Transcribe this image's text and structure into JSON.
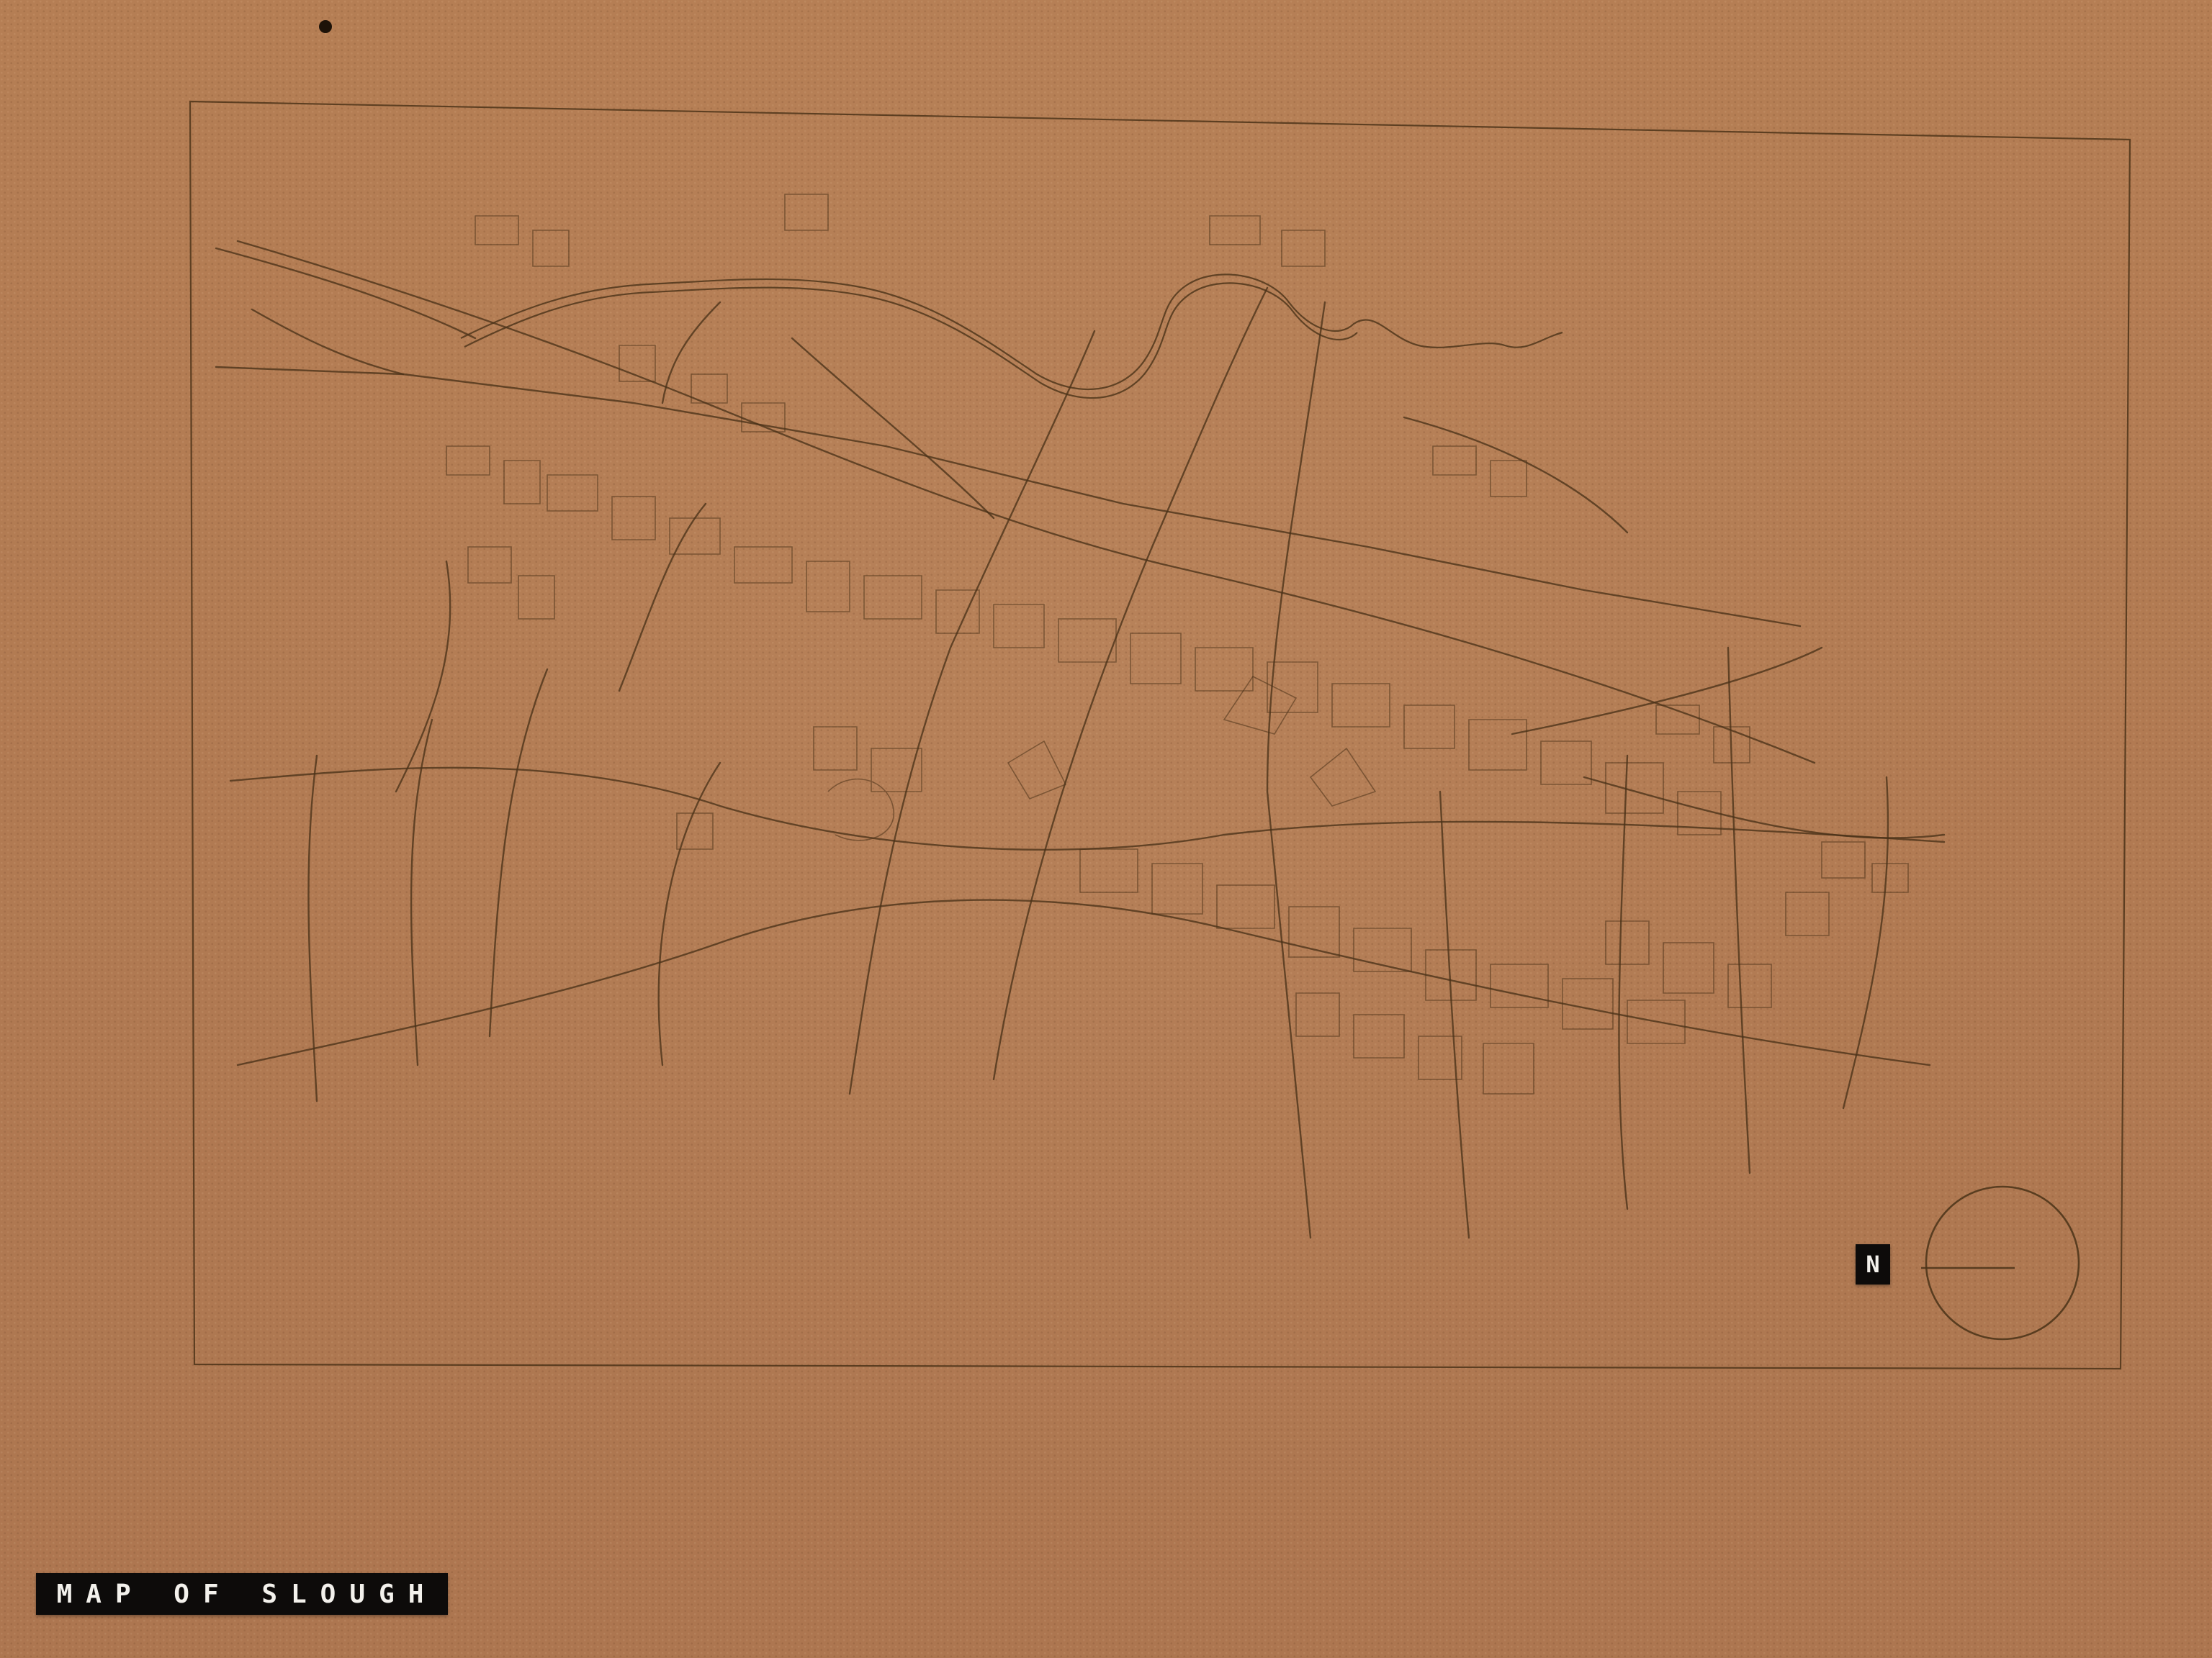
{
  "map": {
    "title_label": "MAP OF SLOUGH",
    "north_label": "N"
  },
  "colors": {
    "board": "#b27b51",
    "ink": "#4a3218",
    "tape": "#0d0b0a",
    "tape_text": "#f3f1ec"
  },
  "icons": {
    "compass": "compass-rose-icon",
    "pin_hole": "pin-hole-icon"
  }
}
